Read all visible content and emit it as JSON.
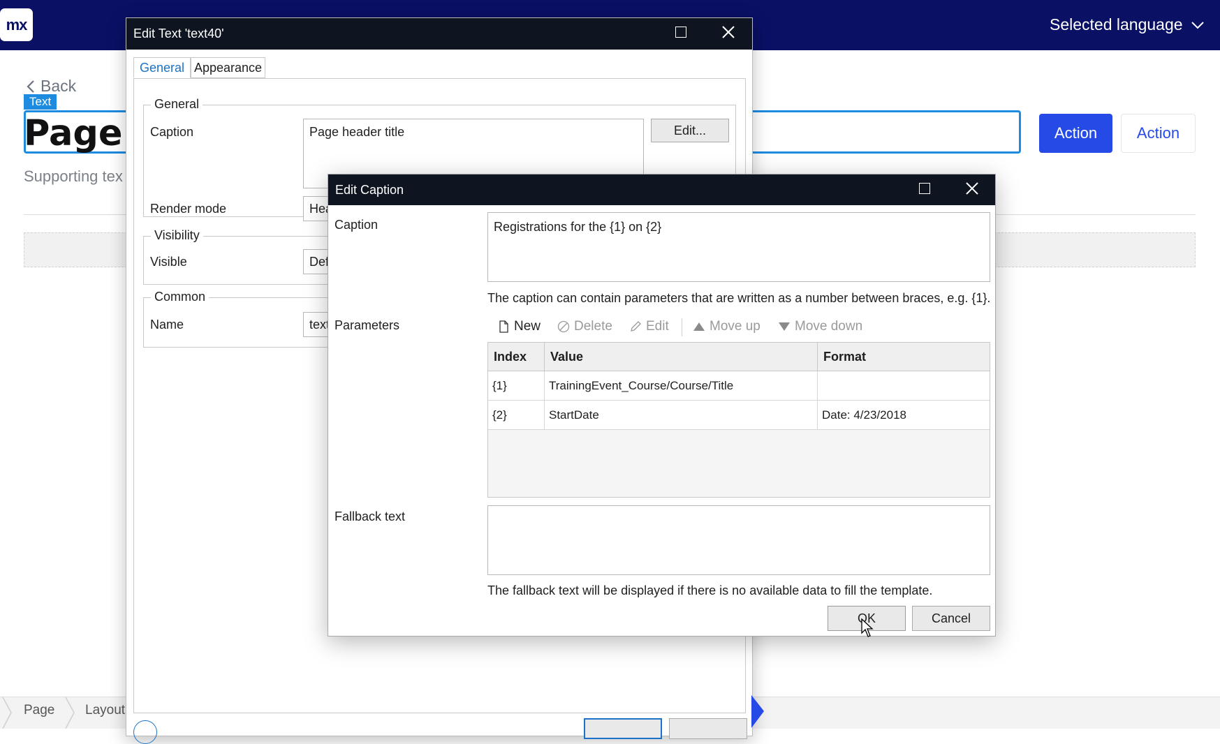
{
  "app": {
    "logo_text": "mx",
    "language_label": "Selected language",
    "back_label": "Back",
    "text_badge": "Text",
    "page_header_text": "Page h",
    "supporting_text": "Supporting tex",
    "action_primary": "Action",
    "action_secondary": "Action",
    "breadcrumb": [
      "Page",
      "Layout"
    ],
    "colors": {
      "topbar": "#0a1064",
      "accent": "#264ae5",
      "selection": "#1c8be0"
    }
  },
  "edit_text_dialog": {
    "title": "Edit Text 'text40'",
    "tabs": [
      {
        "label": "General",
        "active": true
      },
      {
        "label": "Appearance",
        "active": false
      }
    ],
    "general_group": {
      "title": "General",
      "caption_label": "Caption",
      "caption_value": "Page header title",
      "edit_button": "Edit...",
      "render_mode_label": "Render mode",
      "render_mode_value": "Hea"
    },
    "visibility_group": {
      "title": "Visibility",
      "visible_label": "Visible",
      "visible_value": "Def"
    },
    "common_group": {
      "title": "Common",
      "name_label": "Name",
      "name_value": "text"
    }
  },
  "edit_caption_dialog": {
    "title": "Edit Caption",
    "caption_label": "Caption",
    "caption_value": "Registrations for the {1} on {2}",
    "caption_hint": "The caption can contain parameters that are written as a number between braces, e.g. {1}.",
    "parameters_label": "Parameters",
    "toolbar": {
      "new": "New",
      "delete": "Delete",
      "edit": "Edit",
      "move_up": "Move up",
      "move_down": "Move down"
    },
    "columns": [
      "Index",
      "Value",
      "Format"
    ],
    "rows": [
      {
        "index": "{1}",
        "value": "TrainingEvent_Course/Course/Title",
        "format": ""
      },
      {
        "index": "{2}",
        "value": "StartDate",
        "format": "Date: 4/23/2018"
      }
    ],
    "fallback_label": "Fallback text",
    "fallback_value": "",
    "fallback_hint": "The fallback text will be displayed if there is no available data to fill the template.",
    "ok_button": "OK",
    "cancel_button": "Cancel"
  }
}
